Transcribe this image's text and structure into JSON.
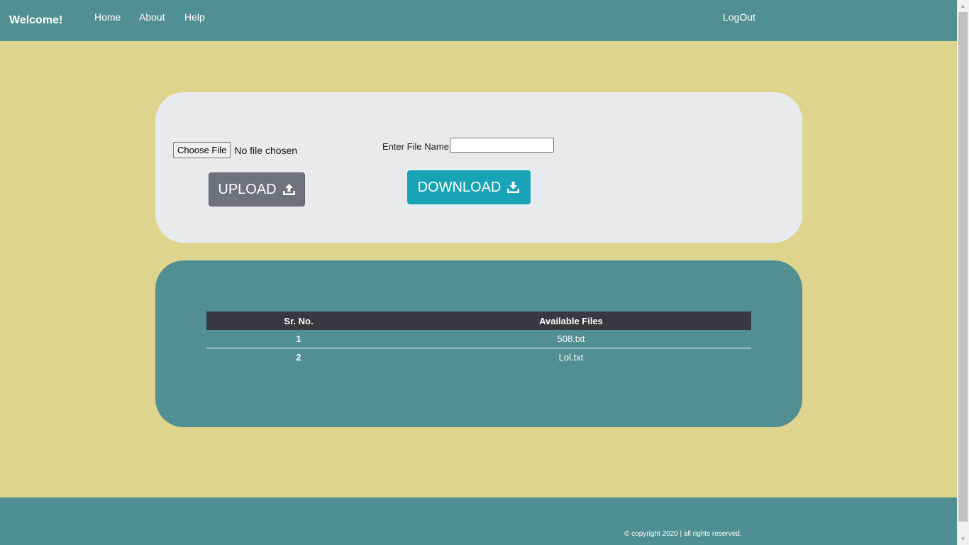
{
  "nav": {
    "brand": "Welcome!",
    "links": [
      "Home",
      "About",
      "Help"
    ],
    "logout": "LogOut"
  },
  "upload": {
    "choose_label": "Choose File",
    "status": "No file chosen",
    "button_label": "UPLOAD"
  },
  "download": {
    "field_label": "Enter File Name:",
    "field_value": "",
    "button_label": "DOWNLOAD"
  },
  "files_table": {
    "headers": [
      "Sr. No.",
      "Available Files"
    ],
    "rows": [
      {
        "num": "1",
        "name": "508.txt"
      },
      {
        "num": "2",
        "name": "Lol.txt"
      }
    ]
  },
  "footer": {
    "copyright": "© copyright 2020 | all rights reserved."
  },
  "colors": {
    "page_background": "#ddd58e",
    "navbar": "#528f92",
    "upload_button": "#6c737c",
    "download_button": "#18a3b7",
    "table_header": "#343a40"
  }
}
